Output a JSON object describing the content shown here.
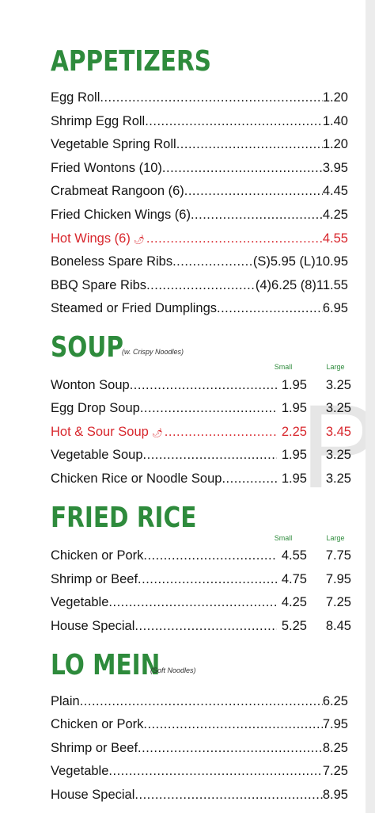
{
  "appetizers": {
    "title": "APPETIZERS",
    "items": [
      {
        "name": "Egg Roll",
        "price": "1.20"
      },
      {
        "name": "Shrimp Egg Roll",
        "price": "1.40"
      },
      {
        "name": "Vegetable Spring Roll",
        "price": "1.20"
      },
      {
        "name": "Fried Wontons (10)",
        "price": "3.95"
      },
      {
        "name": "Crabmeat Rangoon (6)",
        "price": "4.45"
      },
      {
        "name": "Fried Chicken Wings (6)",
        "price": "4.25"
      },
      {
        "name": "Hot Wings (6)",
        "price": "4.55",
        "spicy": true
      },
      {
        "name": "Boneless Spare Ribs",
        "price": "(S)5.95  (L)10.95"
      },
      {
        "name": "BBQ Spare Ribs",
        "price": "(4)6.25  (8)11.55"
      },
      {
        "name": "Steamed or Fried Dumplings",
        "price": "6.95"
      }
    ]
  },
  "soup": {
    "title": "SOUP",
    "note": "(w. Crispy Noodles)",
    "small_label": "Small",
    "large_label": "Large",
    "items": [
      {
        "name": "Wonton Soup",
        "small": "1.95",
        "large": "3.25"
      },
      {
        "name": "Egg Drop Soup",
        "small": "1.95",
        "large": "3.25"
      },
      {
        "name": "Hot & Sour Soup",
        "small": "2.25",
        "large": "3.45",
        "spicy": true
      },
      {
        "name": "Vegetable Soup",
        "small": "1.95",
        "large": "3.25"
      },
      {
        "name": "Chicken Rice or Noodle Soup",
        "small": "1.95",
        "large": "3.25"
      }
    ]
  },
  "fried_rice": {
    "title": "FRIED RICE",
    "small_label": "Small",
    "large_label": "Large",
    "items": [
      {
        "name": "Chicken or Pork",
        "small": "4.55",
        "large": "7.75"
      },
      {
        "name": "Shrimp or Beef",
        "small": "4.75",
        "large": "7.95"
      },
      {
        "name": "Vegetable",
        "small": "4.25",
        "large": "7.25"
      },
      {
        "name": "House Special",
        "small": "5.25",
        "large": "8.45"
      }
    ]
  },
  "lo_mein": {
    "title": "LO MEIN",
    "note": "(Soft Noodles)",
    "items": [
      {
        "name": "Plain",
        "price": "6.25"
      },
      {
        "name": "Chicken or Pork",
        "price": "7.95"
      },
      {
        "name": "Shrimp or Beef",
        "price": "8.25"
      },
      {
        "name": "Vegetable",
        "price": "7.25"
      },
      {
        "name": "House Special",
        "price": "8.95"
      }
    ]
  },
  "watermark": "P",
  "colors": {
    "heading": "#2e8b3c",
    "spicy": "#d8272d",
    "text": "#141414"
  },
  "icons": {
    "spicy": "pepper-icon"
  }
}
